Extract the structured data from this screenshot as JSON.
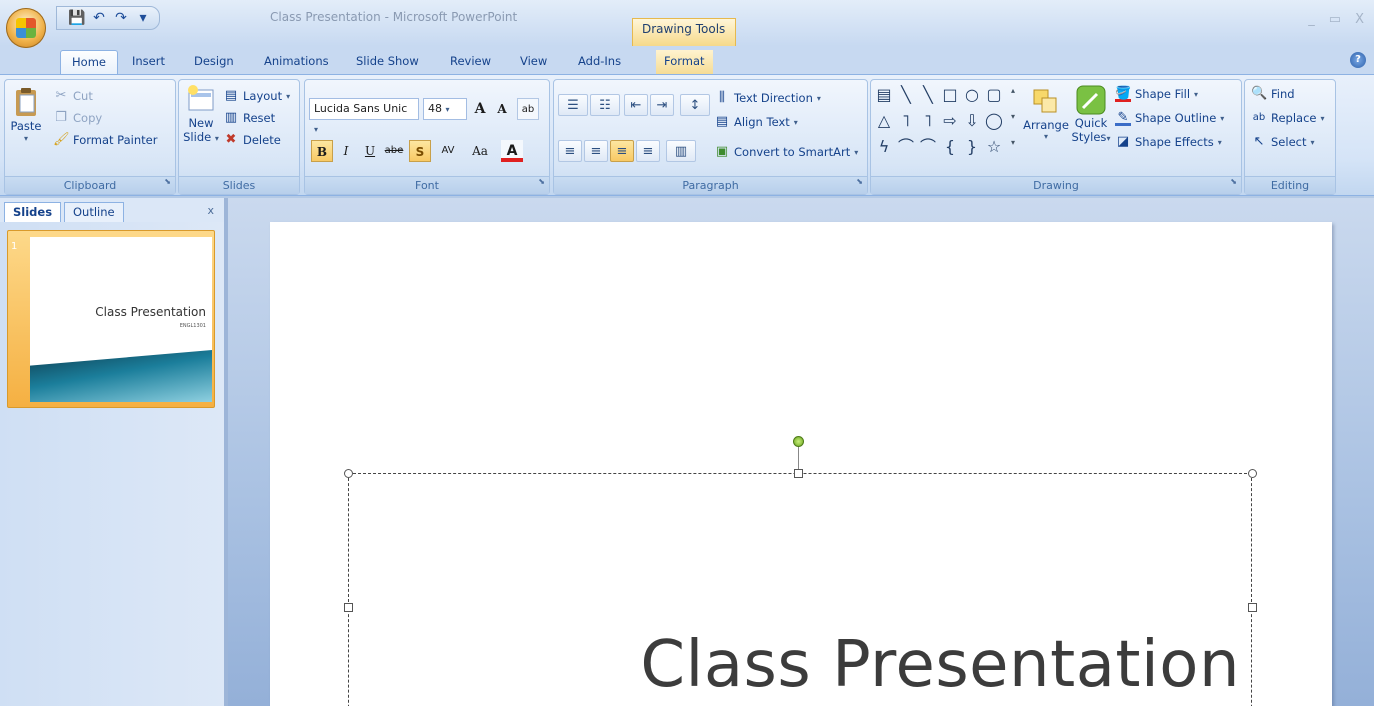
{
  "window": {
    "title": "Class Presentation - Microsoft PowerPoint",
    "context_group": "Drawing Tools",
    "controls": [
      "_",
      "▭",
      "X"
    ]
  },
  "qat": {
    "save": "💾",
    "undo": "↶",
    "redo": "↷",
    "customize": "▾"
  },
  "tabs": [
    {
      "label": "Home",
      "active": true
    },
    {
      "label": "Insert"
    },
    {
      "label": "Design"
    },
    {
      "label": "Animations"
    },
    {
      "label": "Slide Show"
    },
    {
      "label": "Review"
    },
    {
      "label": "View"
    },
    {
      "label": "Add-Ins"
    },
    {
      "label": "Format"
    }
  ],
  "ribbon": {
    "clipboard": {
      "label": "Clipboard",
      "paste": "Paste",
      "cut": "Cut",
      "copy": "Copy",
      "format_painter": "Format Painter"
    },
    "slides": {
      "label": "Slides",
      "new_slide_1": "New",
      "new_slide_2": "Slide",
      "layout": "Layout",
      "reset": "Reset",
      "delete": "Delete"
    },
    "font": {
      "label": "Font",
      "font_name": "Lucida Sans Unic",
      "font_size": "48",
      "grow": "A",
      "shrink": "A",
      "clear": "ab",
      "bold": "B",
      "italic": "I",
      "underline": "U",
      "strike": "abe",
      "shadow": "S",
      "spacing": "AV",
      "change_case": "Aa",
      "color": "A"
    },
    "paragraph": {
      "label": "Paragraph",
      "text_direction": "Text Direction",
      "align_text": "Align Text",
      "smartart": "Convert to SmartArt"
    },
    "drawing": {
      "label": "Drawing",
      "arrange": "Arrange",
      "quick_1": "Quick",
      "quick_2": "Styles",
      "shape_fill": "Shape Fill",
      "shape_outline": "Shape Outline",
      "shape_effects": "Shape Effects",
      "shapes_row1": [
        "▤",
        "╲",
        "╲",
        "□",
        "○",
        "▢"
      ],
      "shapes_row2": [
        "△",
        "˥",
        "˥",
        "⇨",
        "⇩",
        "◯"
      ],
      "shapes_row3": [
        "ϟ",
        "⌒",
        "⌒",
        "{",
        "}",
        "☆"
      ]
    },
    "editing": {
      "label": "Editing",
      "find": "Find",
      "replace": "Replace",
      "select": "Select"
    }
  },
  "left_pane": {
    "tab_slides": "Slides",
    "tab_outline": "Outline",
    "close": "x",
    "thumbnail": {
      "number": "1",
      "title": "Class Presentation",
      "subtitle": "ENGL1301"
    }
  },
  "slide": {
    "title": "Class Presentation"
  }
}
